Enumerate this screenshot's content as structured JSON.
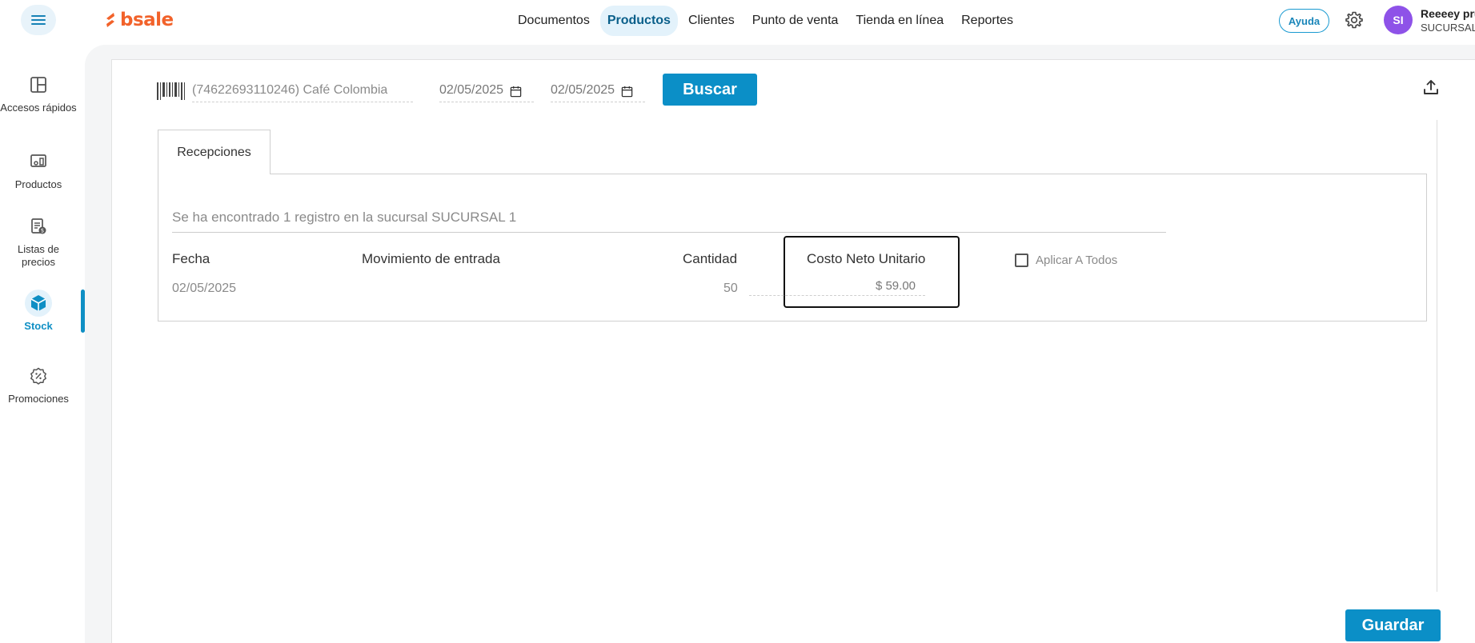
{
  "header": {
    "logo_text": "bsale",
    "nav": [
      {
        "label": "Documentos"
      },
      {
        "label": "Productos",
        "active": true
      },
      {
        "label": "Clientes"
      },
      {
        "label": "Punto de venta"
      },
      {
        "label": "Tienda en línea"
      },
      {
        "label": "Reportes"
      }
    ],
    "help_label": "Ayuda",
    "avatar_initials": "SI",
    "user_name": "Reeeey pru",
    "user_branch": "SUCURSAL"
  },
  "sidebar": {
    "items": [
      {
        "label": "Accesos rápidos",
        "icon": "grid-icon"
      },
      {
        "label": "Productos",
        "icon": "products-icon"
      },
      {
        "label": "Listas de precios",
        "icon": "price-list-icon"
      },
      {
        "label": "Stock",
        "icon": "box-icon",
        "active": true
      },
      {
        "label": "Promociones",
        "icon": "promo-icon"
      }
    ]
  },
  "search": {
    "product_value": "(74622693110246) Café Colombia",
    "date_from": "02/05/2025",
    "date_to": "02/05/2025",
    "search_button": "Buscar"
  },
  "tabs": [
    {
      "label": "Recepciones",
      "active": true
    }
  ],
  "results": {
    "found_text": "Se ha encontrado 1 registro en la sucursal SUCURSAL 1",
    "columns": {
      "date": "Fecha",
      "movement": "Movimiento de entrada",
      "quantity": "Cantidad",
      "unit_cost": "Costo Neto Unitario"
    },
    "rows": [
      {
        "date": "02/05/2025",
        "movement": "",
        "quantity": "50",
        "unit_cost": "$ 59.00"
      }
    ],
    "apply_all_label": "Aplicar A Todos",
    "apply_all_checked": false
  },
  "save_button": "Guardar",
  "colors": {
    "brand": "#f2622a",
    "primary": "#0b8fc7",
    "avatar": "#8e52e8"
  }
}
